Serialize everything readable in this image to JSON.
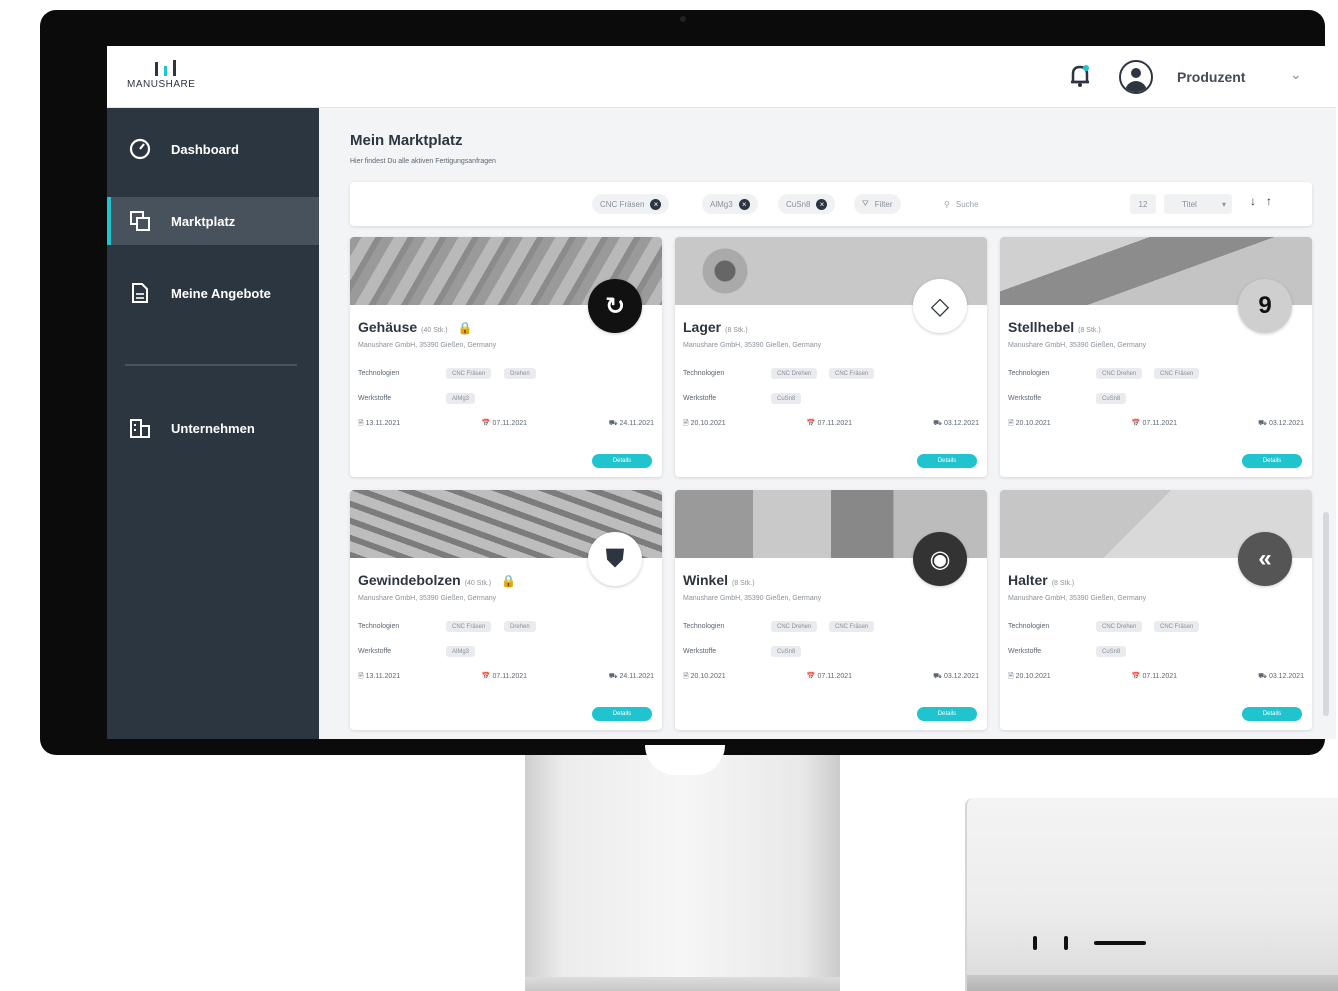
{
  "brand": {
    "logo_text": "MANUSHARE"
  },
  "header": {
    "user_name": "Produzent"
  },
  "sidebar": {
    "items": [
      {
        "label": "Dashboard",
        "icon": "speedometer-icon"
      },
      {
        "label": "Marktplatz",
        "icon": "copy-icon"
      },
      {
        "label": "Meine Angebote",
        "icon": "document-icon"
      },
      {
        "label": "Unternehmen",
        "icon": "building-icon"
      }
    ],
    "active": "Marktplatz"
  },
  "page": {
    "title": "Mein Marktplatz",
    "subtitle": "Hier findest Du alle aktiven Fertigungsanfragen"
  },
  "filters": {
    "chips": [
      "CNC Fräsen",
      "AlMg3",
      "CuSn8"
    ],
    "filter_label": "Filter",
    "search_placeholder": "Suche",
    "per_page": "12",
    "sort_label": "Titel"
  },
  "labels": {
    "technologies": "Technologien",
    "materials": "Werkstoffe",
    "details": "Details"
  },
  "cards": [
    {
      "name": "Gehäuse",
      "qty": "(40 Stk.)",
      "locked": true,
      "company": "Manushare GmbH, 35390 Gießen, Germany",
      "tech": [
        "CNC Fräsen",
        "Drehen"
      ],
      "material": [
        "AlMg3"
      ],
      "dates": [
        "13.11.2021",
        "07.11.2021",
        "24.11.2021"
      ],
      "badge": "↻",
      "badge_bg": "#111111",
      "badge_fg": "#ffffff"
    },
    {
      "name": "Lager",
      "qty": "(8 Stk.)",
      "locked": false,
      "company": "Manushare GmbH, 35390 Gießen, Germany",
      "tech": [
        "CNC Drehen",
        "CNC Fräsen"
      ],
      "material": [
        "CuSn8"
      ],
      "dates": [
        "20.10.2021",
        "07.11.2021",
        "03.12.2021"
      ],
      "badge": "◇",
      "badge_bg": "#ffffff",
      "badge_fg": "#2d3640"
    },
    {
      "name": "Stellhebel",
      "qty": "(8 Stk.)",
      "locked": false,
      "company": "Manushare GmbH, 35390 Gießen, Germany",
      "tech": [
        "CNC Drehen",
        "CNC Fräsen"
      ],
      "material": [
        "CuSn8"
      ],
      "dates": [
        "20.10.2021",
        "07.11.2021",
        "03.12.2021"
      ],
      "badge": "9",
      "badge_bg": "#cfcfcf",
      "badge_fg": "#111111"
    },
    {
      "name": "Gewindebolzen",
      "qty": "(40 Stk.)",
      "locked": true,
      "company": "Manushare GmbH, 35390 Gießen, Germany",
      "tech": [
        "CNC Fräsen",
        "Drehen"
      ],
      "material": [
        "AlMg3"
      ],
      "dates": [
        "13.11.2021",
        "07.11.2021",
        "24.11.2021"
      ],
      "badge": "⛊",
      "badge_bg": "#ffffff",
      "badge_fg": "#2d3640"
    },
    {
      "name": "Winkel",
      "qty": "(8 Stk.)",
      "locked": false,
      "company": "Manushare GmbH, 35390 Gießen, Germany",
      "tech": [
        "CNC Drehen",
        "CNC Fräsen"
      ],
      "material": [
        "CuSn8"
      ],
      "dates": [
        "20.10.2021",
        "07.11.2021",
        "03.12.2021"
      ],
      "badge": "◉",
      "badge_bg": "#333333",
      "badge_fg": "#ffffff"
    },
    {
      "name": "Halter",
      "qty": "(8 Stk.)",
      "locked": false,
      "company": "Manushare GmbH, 35390 Gießen, Germany",
      "tech": [
        "CNC Drehen",
        "CNC Fräsen"
      ],
      "material": [
        "CuSn8"
      ],
      "dates": [
        "20.10.2021",
        "07.11.2021",
        "03.12.2021"
      ],
      "badge": "«",
      "badge_bg": "#555555",
      "badge_fg": "#ffffff"
    }
  ]
}
